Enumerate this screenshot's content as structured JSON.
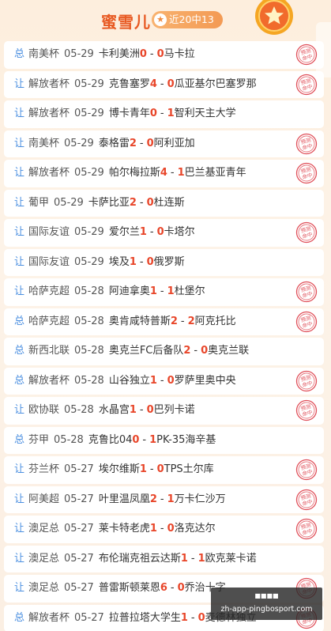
{
  "header": {
    "name": "蜜雪儿",
    "badge": "近20中13",
    "badge_icon": "star-icon"
  },
  "colors": {
    "accent": "#e85a23",
    "score": "#e8462a",
    "kind": "#4b8fe0",
    "stamp": "#e0505a"
  },
  "stamp_text": [
    "预测",
    "命中"
  ],
  "matches": [
    {
      "kind": "总",
      "league": "南美杯",
      "date": "05-29",
      "home": "卡利美洲",
      "hs": "0",
      "as": "0",
      "away": "马卡拉",
      "hit": true
    },
    {
      "kind": "让",
      "league": "解放者杯",
      "date": "05-29",
      "home": "克鲁塞罗",
      "hs": "4",
      "as": "0",
      "away": "瓜亚基尔巴塞罗那",
      "hit": true
    },
    {
      "kind": "让",
      "league": "解放者杯",
      "date": "05-29",
      "home": "博卡青年",
      "hs": "0",
      "as": "1",
      "away": "智利天主大学",
      "hit": false
    },
    {
      "kind": "让",
      "league": "南美杯",
      "date": "05-29",
      "home": "泰格雷",
      "hs": "2",
      "as": "0",
      "away": "阿利亚加",
      "hit": true
    },
    {
      "kind": "让",
      "league": "解放者杯",
      "date": "05-29",
      "home": "帕尔梅拉斯",
      "hs": "4",
      "as": "1",
      "away": "巴兰基亚青年",
      "hit": true
    },
    {
      "kind": "让",
      "league": "葡甲",
      "date": "05-29",
      "home": "卡萨比亚",
      "hs": "2",
      "as": "0",
      "away": "杜连斯",
      "hit": false
    },
    {
      "kind": "让",
      "league": "国际友谊",
      "date": "05-29",
      "home": "爱尔兰",
      "hs": "1",
      "as": "0",
      "away": "卡塔尔",
      "hit": true
    },
    {
      "kind": "让",
      "league": "国际友谊",
      "date": "05-29",
      "home": "埃及",
      "hs": "1",
      "as": "0",
      "away": "俄罗斯",
      "hit": false
    },
    {
      "kind": "让",
      "league": "哈萨克超",
      "date": "05-28",
      "home": "阿迪拿奥",
      "hs": "1",
      "as": "1",
      "away": "杜堡尔",
      "hit": true
    },
    {
      "kind": "总",
      "league": "哈萨克超",
      "date": "05-28",
      "home": "奥肯咸特普斯",
      "hs": "2",
      "as": "2",
      "away": "阿克托比",
      "hit": true
    },
    {
      "kind": "总",
      "league": "新西北联",
      "date": "05-28",
      "home": "奥克兰FC后备队",
      "hs": "2",
      "as": "0",
      "away": "奥克兰联",
      "hit": false
    },
    {
      "kind": "总",
      "league": "解放者杯",
      "date": "05-28",
      "home": "山谷独立",
      "hs": "1",
      "as": "0",
      "away": "罗萨里奥中央",
      "hit": true
    },
    {
      "kind": "让",
      "league": "欧协联",
      "date": "05-28",
      "home": "水晶宫",
      "hs": "1",
      "as": "0",
      "away": "巴列卡诺",
      "hit": true
    },
    {
      "kind": "总",
      "league": "芬甲",
      "date": "05-28",
      "home": "克鲁比04",
      "hs": "0",
      "as": "1",
      "away": "PK-35海辛基",
      "hit": false
    },
    {
      "kind": "让",
      "league": "芬兰杯",
      "date": "05-27",
      "home": "埃尔维斯",
      "hs": "1",
      "as": "0",
      "away": "TPS土尔库",
      "hit": true
    },
    {
      "kind": "让",
      "league": "阿美超",
      "date": "05-27",
      "home": "叶里温凤凰",
      "hs": "2",
      "as": "1",
      "away": "万卡仁沙万",
      "hit": true
    },
    {
      "kind": "让",
      "league": "澳足总",
      "date": "05-27",
      "home": "莱卡特老虎",
      "hs": "1",
      "as": "0",
      "away": "洛克达尔",
      "hit": true
    },
    {
      "kind": "让",
      "league": "澳足总",
      "date": "05-27",
      "home": "布伦瑞克祖云达斯",
      "hs": "1",
      "as": "1",
      "away": "欧克莱卡诺",
      "hit": false
    },
    {
      "kind": "让",
      "league": "澳足总",
      "date": "05-27",
      "home": "普雷斯顿莱恩",
      "hs": "6",
      "as": "0",
      "away": "乔治十字",
      "hit": true
    },
    {
      "kind": "总",
      "league": "解放者杯",
      "date": "05-27",
      "home": "拉普拉塔大学生",
      "hs": "1",
      "as": "0",
      "away": "麦德林独立",
      "hit": true
    }
  ],
  "watermark": {
    "line1": "■■■■",
    "line2": "zh-app-pingbosport.com"
  }
}
